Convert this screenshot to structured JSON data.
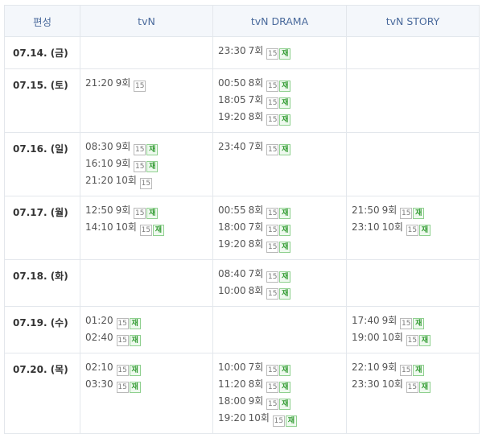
{
  "header": {
    "date_col": "편성",
    "channels": [
      "tvN",
      "tvN DRAMA",
      "tvN STORY"
    ]
  },
  "rows": [
    {
      "date": "07.14. (금)",
      "cells": [
        [],
        [
          {
            "time": "23:30",
            "ep": "7회",
            "age": "15",
            "re": "재"
          }
        ],
        []
      ]
    },
    {
      "date": "07.15. (토)",
      "cells": [
        [
          {
            "time": "21:20",
            "ep": "9회",
            "age": "15",
            "re": ""
          }
        ],
        [
          {
            "time": "00:50",
            "ep": "8회",
            "age": "15",
            "re": "재"
          },
          {
            "time": "18:05",
            "ep": "7회",
            "age": "15",
            "re": "재"
          },
          {
            "time": "19:20",
            "ep": "8회",
            "age": "15",
            "re": "재"
          }
        ],
        []
      ]
    },
    {
      "date": "07.16. (일)",
      "cells": [
        [
          {
            "time": "08:30",
            "ep": "9회",
            "age": "15",
            "re": "재"
          },
          {
            "time": "16:10",
            "ep": "9회",
            "age": "15",
            "re": "재"
          },
          {
            "time": "21:20",
            "ep": "10회",
            "age": "15",
            "re": ""
          }
        ],
        [
          {
            "time": "23:40",
            "ep": "7회",
            "age": "15",
            "re": "재"
          }
        ],
        []
      ]
    },
    {
      "date": "07.17. (월)",
      "cells": [
        [
          {
            "time": "12:50",
            "ep": "9회",
            "age": "15",
            "re": "재"
          },
          {
            "time": "14:10",
            "ep": "10회",
            "age": "15",
            "re": "재"
          }
        ],
        [
          {
            "time": "00:55",
            "ep": "8회",
            "age": "15",
            "re": "재"
          },
          {
            "time": "18:00",
            "ep": "7회",
            "age": "15",
            "re": "재"
          },
          {
            "time": "19:20",
            "ep": "8회",
            "age": "15",
            "re": "재"
          }
        ],
        [
          {
            "time": "21:50",
            "ep": "9회",
            "age": "15",
            "re": "재"
          },
          {
            "time": "23:10",
            "ep": "10회",
            "age": "15",
            "re": "재"
          }
        ]
      ]
    },
    {
      "date": "07.18. (화)",
      "cells": [
        [],
        [
          {
            "time": "08:40",
            "ep": "7회",
            "age": "15",
            "re": "재"
          },
          {
            "time": "10:00",
            "ep": "8회",
            "age": "15",
            "re": "재"
          }
        ],
        []
      ]
    },
    {
      "date": "07.19. (수)",
      "cells": [
        [
          {
            "time": "01:20",
            "ep": "",
            "age": "15",
            "re": "재"
          },
          {
            "time": "02:40",
            "ep": "",
            "age": "15",
            "re": "재"
          }
        ],
        [],
        [
          {
            "time": "17:40",
            "ep": "9회",
            "age": "15",
            "re": "재"
          },
          {
            "time": "19:00",
            "ep": "10회",
            "age": "15",
            "re": "재"
          }
        ]
      ]
    },
    {
      "date": "07.20. (목)",
      "cells": [
        [
          {
            "time": "02:10",
            "ep": "",
            "age": "15",
            "re": "재"
          },
          {
            "time": "03:30",
            "ep": "",
            "age": "15",
            "re": "재"
          }
        ],
        [
          {
            "time": "10:00",
            "ep": "7회",
            "age": "15",
            "re": "재"
          },
          {
            "time": "11:20",
            "ep": "8회",
            "age": "15",
            "re": "재"
          },
          {
            "time": "18:00",
            "ep": "9회",
            "age": "15",
            "re": "재"
          },
          {
            "time": "19:20",
            "ep": "10회",
            "age": "15",
            "re": "재"
          }
        ],
        [
          {
            "time": "22:10",
            "ep": "9회",
            "age": "15",
            "re": "재"
          },
          {
            "time": "23:30",
            "ep": "10회",
            "age": "15",
            "re": "재"
          }
        ]
      ]
    }
  ],
  "colors": {
    "header_bg": "#f4f7fb",
    "header_text": "#4a6a9c",
    "border": "#e3e7ec",
    "rerun_green": "#2f9a2f"
  }
}
